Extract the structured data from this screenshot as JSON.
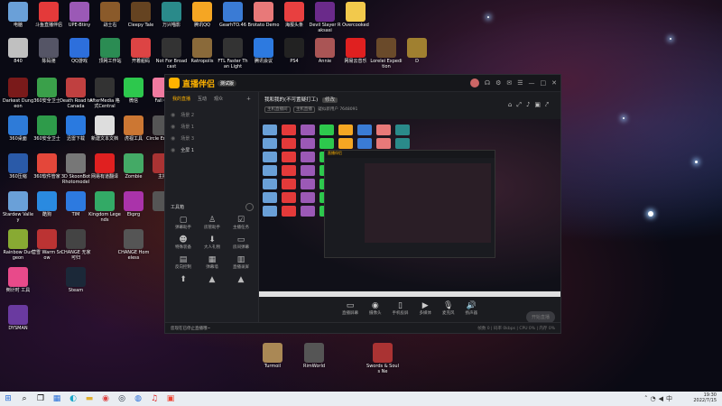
{
  "desktop": {
    "left_icons": [
      {
        "label": "电脑",
        "color": "#6aa0d8"
      },
      {
        "label": "斗鱼直播伴侣",
        "color": "#e43a3a"
      },
      {
        "label": "UPE-Btiny",
        "color": "#9b59b6"
      },
      {
        "label": "战士右",
        "color": "#8a5a2a"
      },
      {
        "label": "Cleepy Tale",
        "color": "#654321"
      },
      {
        "label": "万兴喵影",
        "color": "#2a8a8a"
      },
      {
        "label": "腾讯QQ",
        "color": "#f5a623"
      },
      {
        "label": "GearhTO.46",
        "color": "#3a7bd5"
      },
      {
        "label": "Brotato Demo",
        "color": "#e87979"
      },
      {
        "label": "海报头条",
        "color": "#e84040"
      },
      {
        "label": "Devil Slayer Raksasi",
        "color": "#6a2a8a"
      },
      {
        "label": "Overcooked",
        "color": "#f2c94c"
      },
      {
        "label": "840",
        "color": "#c0c0c0"
      },
      {
        "label": "陈码驰",
        "color": "#556"
      },
      {
        "label": "QQ游戏",
        "color": "#2d6fdc"
      },
      {
        "label": "顶网工作站",
        "color": "#2b8c53"
      },
      {
        "label": "开着船码",
        "color": "#d44"
      },
      {
        "label": "Not For Broadcast",
        "color": "#333"
      },
      {
        "label": "Ratropolis",
        "color": "#8a6a3a"
      },
      {
        "label": "FTL Faster Than Light",
        "color": "#333"
      },
      {
        "label": "腾讯会议",
        "color": "#2d7ae0"
      },
      {
        "label": "PS4",
        "color": "#222"
      },
      {
        "label": "Annie",
        "color": "#a55"
      },
      {
        "label": "网易云音乐",
        "color": "#e02020"
      },
      {
        "label": "Lorelei Expedition",
        "color": "#6a4a2a"
      },
      {
        "label": "D",
        "color": "#a08030"
      }
    ],
    "col_icons": [
      {
        "label": "Darkest Dungeon",
        "color": "#7a1a1a"
      },
      {
        "label": "360安全卫士",
        "color": "#3aa04a"
      },
      {
        "label": "Death Road to Canada",
        "color": "#c04040"
      },
      {
        "label": "AfterMedia 格式Central",
        "color": "#333"
      },
      {
        "label": "微信",
        "color": "#2dc84d"
      },
      {
        "label": "Fall Gu",
        "color": "#f07aa0"
      },
      {
        "label": "360桌面",
        "color": "#2e7bd8"
      },
      {
        "label": "360安全卫士",
        "color": "#2e9b4a"
      },
      {
        "label": "迅雷下载",
        "color": "#2a7ae0"
      },
      {
        "label": "新建文本文档",
        "color": "#ddd"
      },
      {
        "label": "虎视工具",
        "color": "#c73"
      },
      {
        "label": "Circle Empires",
        "color": "#555"
      },
      {
        "label": "360压缩",
        "color": "#2a5aa8"
      },
      {
        "label": "360软件管家",
        "color": "#e4473a"
      },
      {
        "label": "3D SkoonBot Rhotomodel",
        "color": "#777"
      },
      {
        "label": "网易有道翻译",
        "color": "#e02020"
      },
      {
        "label": "Zombie",
        "color": "#4a6"
      },
      {
        "label": "主播",
        "color": "#a33"
      },
      {
        "label": "Stardew Valley",
        "color": "#6aa0d8"
      },
      {
        "label": "酷狗",
        "color": "#2a8ae0"
      },
      {
        "label": "TIM",
        "color": "#2d7ae0"
      },
      {
        "label": "Kingdom Legends",
        "color": "#3a6"
      },
      {
        "label": "Ekprg",
        "color": "#a3a"
      },
      {
        "label": "",
        "color": "#555"
      },
      {
        "label": "Rainbow Dungeon",
        "color": "#8a3"
      },
      {
        "label": "营雪 Warm Snow",
        "color": "#b33"
      },
      {
        "label": "CHANGE 无家可归",
        "color": "#444"
      },
      {
        "label": "CHANGE Homeless",
        "color": "#555"
      },
      {
        "label": "倒计时 工具",
        "color": "#e84a8a"
      },
      {
        "label": "Steam",
        "color": "#1b2838"
      },
      {
        "label": "DYSMAN",
        "color": "#6a3aa0"
      }
    ],
    "bottom_icons": [
      {
        "label": "Turmoil",
        "color": "#a85"
      },
      {
        "label": "RimWorld",
        "color": "#555"
      },
      {
        "label": "Swords & Souls Ne",
        "color": "#a33"
      }
    ]
  },
  "app": {
    "logo_text": "直播伴侣",
    "version": "测试版",
    "tabs": [
      "我的直播",
      "互动",
      "观众"
    ],
    "scenes": [
      "场景 2",
      "场景 1",
      "场景 3",
      "全屏 1"
    ],
    "tools_header": "工具箱",
    "tools": [
      "弹幕助手",
      "房管助手",
      "主播任务",
      "特殊装备",
      "大人礼物",
      "房间弹幕",
      "反向控制",
      "弹幕墙",
      "直播录屏",
      "",
      "",
      ""
    ],
    "room_title": "我和我的(不可置疑打工)",
    "room_tag": "修改",
    "room_info": [
      "主机直播间",
      "主机直播",
      "疑似新用户",
      "7648091"
    ],
    "controls": [
      "直播屏幕",
      "摄像头",
      "手机投屏",
      "多媒体",
      "麦克风",
      "扬声器"
    ],
    "go_live": "开始直播",
    "status_left": "您现在已停止直播哦~",
    "status_right": "帧数 0  |  码率 0kbps  |  CPU 0%  |  内存 0%"
  },
  "taskbar": {
    "apps": [
      "search",
      "task",
      "store",
      "edge",
      "files",
      "chrome",
      "steam",
      "explorer",
      "music",
      "app1"
    ],
    "time": "19:30",
    "date": "2022/7/15"
  }
}
